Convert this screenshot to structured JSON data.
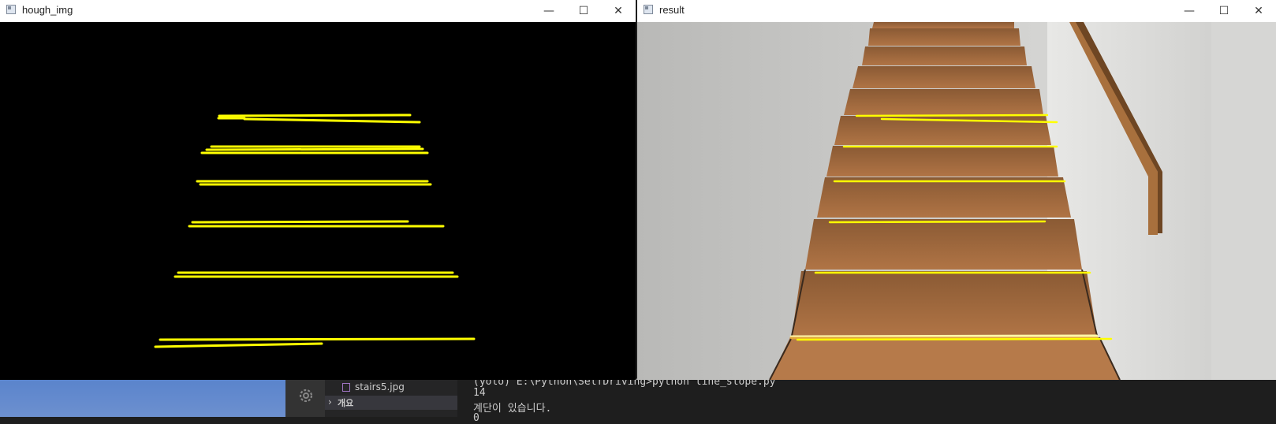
{
  "windows": {
    "hough": {
      "title": "hough_img"
    },
    "result": {
      "title": "result"
    }
  },
  "window_controls": {
    "minimize": "—",
    "maximize": "☐",
    "close": "✕"
  },
  "explorer": {
    "file_label": "stairs5.jpg",
    "section_label": "개요"
  },
  "terminal": {
    "line1": "(yolo) E:\\Python\\SelfDriving>python line_slope.py",
    "line2": "14",
    "line3": "계단이 있습니다.",
    "line4": "0"
  },
  "colors": {
    "line_yellow": "#ffff00",
    "title_bg": "#ffffff",
    "image_bg": "#000000"
  },
  "icons": {
    "window_app": "window-app-icon",
    "gear": "gear-icon",
    "chevron": "chevron-right-icon",
    "image_file": "image-file-icon"
  }
}
